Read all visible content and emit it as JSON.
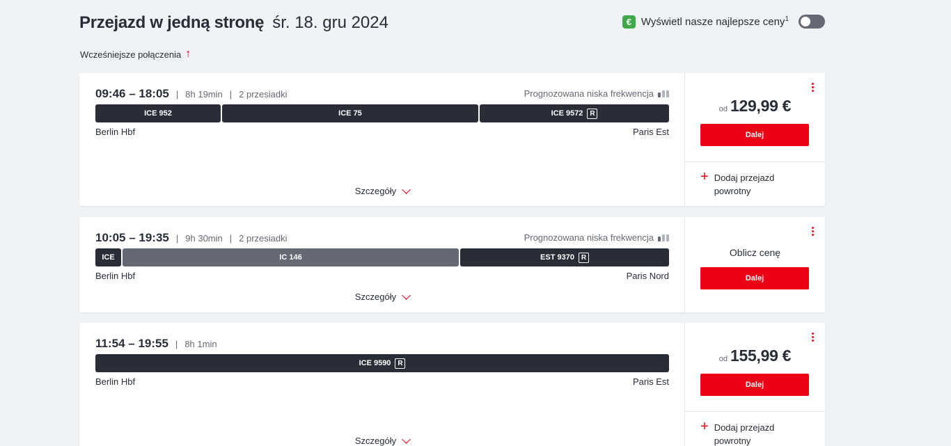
{
  "header": {
    "title": "Przejazd w jedną stronę",
    "date": "śr. 18. gru 2024",
    "best_price_label": "Wyświetl nasze najlepsze ceny",
    "best_price_sup": "1",
    "euro_symbol": "€",
    "toggle_on": false
  },
  "earlier_label": "Wcześniejsze połączenia",
  "connections": [
    {
      "time_range": "09:46 – 18:05",
      "duration": "8h 19min",
      "transfers": "2 przesiadki",
      "occupancy": "Prognozowana niska frekwencja",
      "segments": [
        {
          "label": "ICE 952",
          "reservation": false
        },
        {
          "label": "ICE 75",
          "reservation": false
        },
        {
          "label": "ICE 9572",
          "reservation": true
        }
      ],
      "from": "Berlin Hbf",
      "to": "Paris Est",
      "details_label": "Szczegóły",
      "price_prefix": "od",
      "price": "129,99 €",
      "button_label": "Dalej",
      "return_label": "Dodaj przejazd powrotny"
    },
    {
      "time_range": "10:05 – 19:35",
      "duration": "9h 30min",
      "transfers": "2 przesiadki",
      "occupancy": "Prognozowana niska frekwencja",
      "segments": [
        {
          "label": "ICE",
          "reservation": false
        },
        {
          "label": "IC 146",
          "reservation": false
        },
        {
          "label": "EST 9370",
          "reservation": true
        }
      ],
      "from": "Berlin Hbf",
      "to": "Paris Nord",
      "details_label": "Szczegóły",
      "calc_label": "Oblicz cenę",
      "button_label": "Dalej"
    },
    {
      "time_range": "11:54 – 19:55",
      "duration": "8h 1min",
      "segments": [
        {
          "label": "ICE 9590",
          "reservation": true
        }
      ],
      "from": "Berlin Hbf",
      "to": "Paris Est",
      "details_label": "Szczegóły",
      "price_prefix": "od",
      "price": "155,99 €",
      "button_label": "Dalej",
      "return_label": "Dodaj przejazd powrotny"
    }
  ],
  "reservation_mark": "R",
  "colors": {
    "accent": "#ec0016",
    "dark_segment": "#282d37",
    "grey_segment": "#646973",
    "euro_badge": "#3ea84a",
    "background": "#f0f3f5"
  },
  "icons": [
    "euro-icon",
    "toggle-switch",
    "arrow-up-icon",
    "occupancy-icon",
    "chevron-down-icon",
    "kebab-menu-icon",
    "plus-icon",
    "reservation-icon"
  ]
}
